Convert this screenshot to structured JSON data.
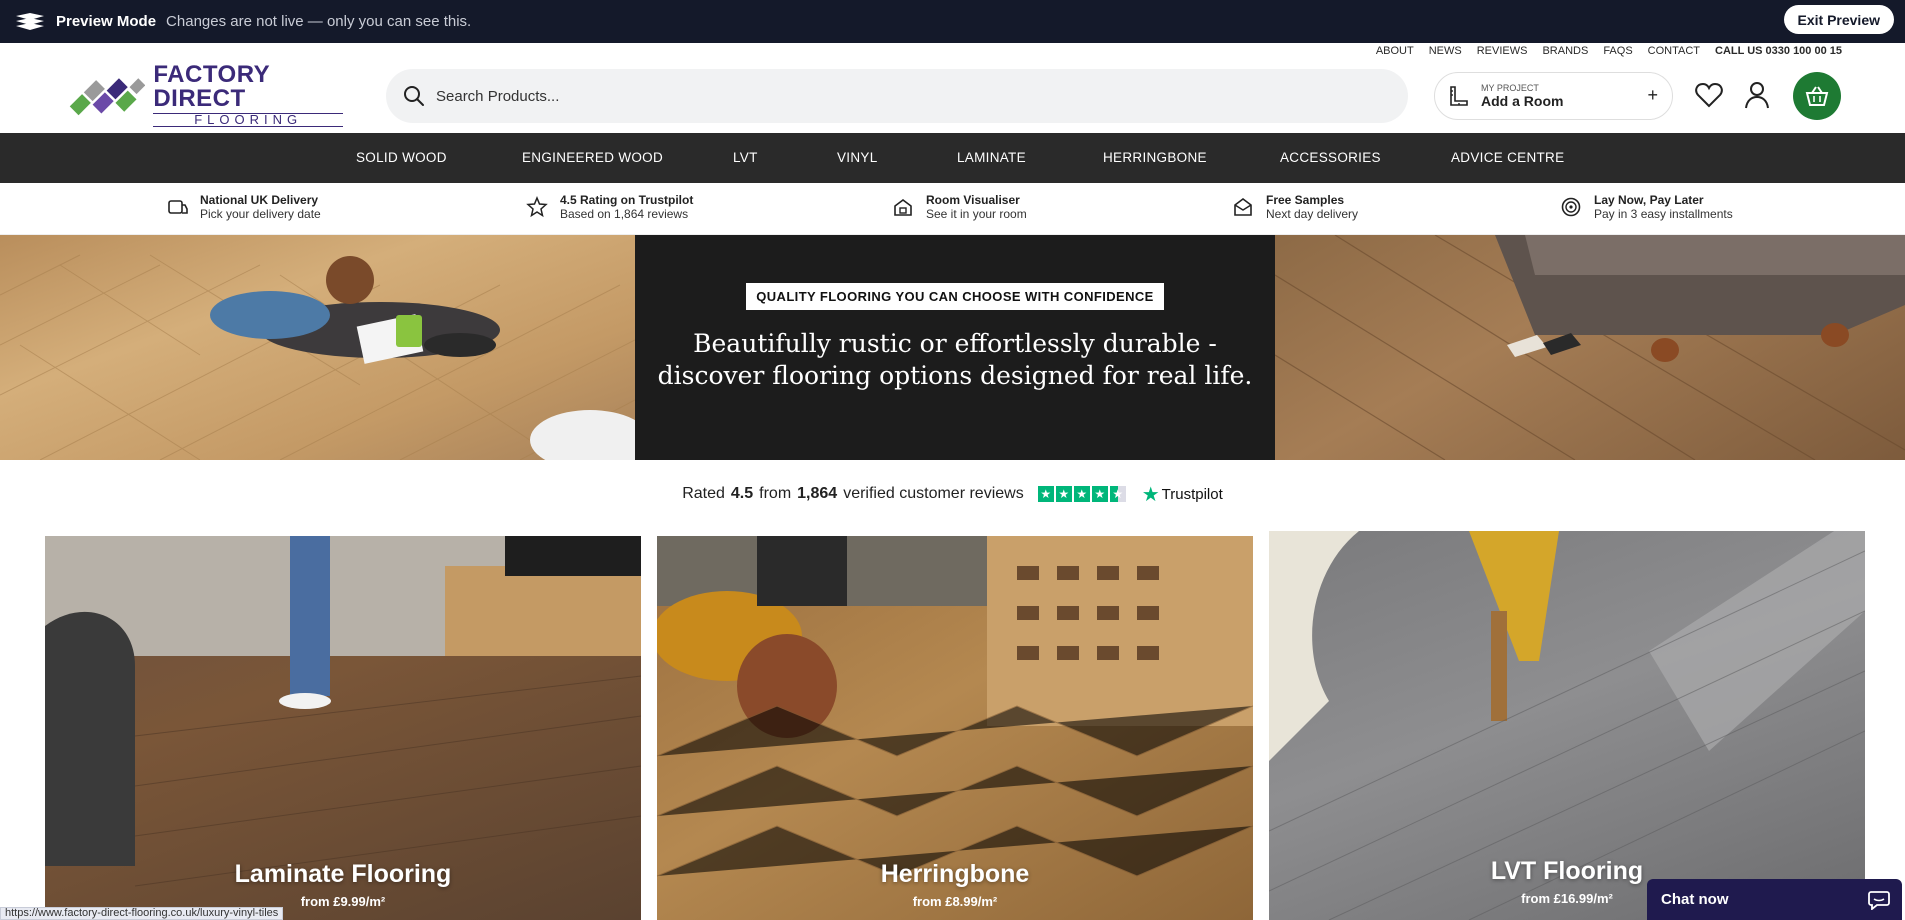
{
  "preview": {
    "title": "Preview Mode",
    "text": "Changes are not live — only you can see this.",
    "exit_label": "Exit Preview"
  },
  "util_nav": [
    "ABOUT",
    "NEWS",
    "REVIEWS",
    "BRANDS",
    "FAQS",
    "CONTACT"
  ],
  "call": "CALL US 0330 100 00 15",
  "brand": {
    "line1": "FACTORY DIRECT",
    "line2": "FLOORING"
  },
  "search": {
    "placeholder": "Search Products..."
  },
  "project": {
    "small": "MY PROJECT",
    "label": "Add a Room",
    "plus": "+"
  },
  "main_nav": [
    "SOLID WOOD",
    "ENGINEERED WOOD",
    "LVT",
    "VINYL",
    "LAMINATE",
    "HERRINGBONE",
    "ACCESSORIES",
    "ADVICE CENTRE"
  ],
  "usps": [
    {
      "title": "National UK Delivery",
      "sub": "Pick your delivery date",
      "icon": "delivery-icon"
    },
    {
      "title": "4.5 Rating on Trustpilot",
      "sub": "Based on 1,864 reviews",
      "icon": "rating-icon"
    },
    {
      "title": "Room Visualiser",
      "sub": "See it in your room",
      "icon": "visualiser-icon"
    },
    {
      "title": "Free Samples",
      "sub": "Next day delivery",
      "icon": "samples-icon"
    },
    {
      "title": "Lay Now, Pay Later",
      "sub": "Pay in 3 easy installments",
      "icon": "pay-later-icon"
    }
  ],
  "hero": {
    "tag": "QUALITY FLOORING YOU CAN CHOOSE WITH CONFIDENCE",
    "headline_1": "Beautifully rustic or effortlessly durable -",
    "headline_2": "discover flooring options designed for real life."
  },
  "trustpilot": {
    "pre": "Rated",
    "rating": "4.5",
    "mid": "from",
    "count": "1,864",
    "post": "verified customer reviews",
    "brand": "Trustpilot"
  },
  "cards": [
    {
      "title": "Laminate Flooring",
      "price": "from £9.99/m²"
    },
    {
      "title": "Herringbone",
      "price": "from £8.99/m²"
    },
    {
      "title": "LVT Flooring",
      "price": "from £16.99/m²"
    }
  ],
  "status_url": "https://www.factory-direct-flooring.co.uk/luxury-vinyl-tiles",
  "chat": {
    "label": "Chat now"
  },
  "colors": {
    "preview_bar": "#14192a",
    "brand_purple": "#3b2a79",
    "basket_green": "#1e7a33",
    "nav_bg": "#2a2a2a",
    "trustpilot_green": "#00b67a",
    "chat_bg": "#1f1a4e"
  }
}
